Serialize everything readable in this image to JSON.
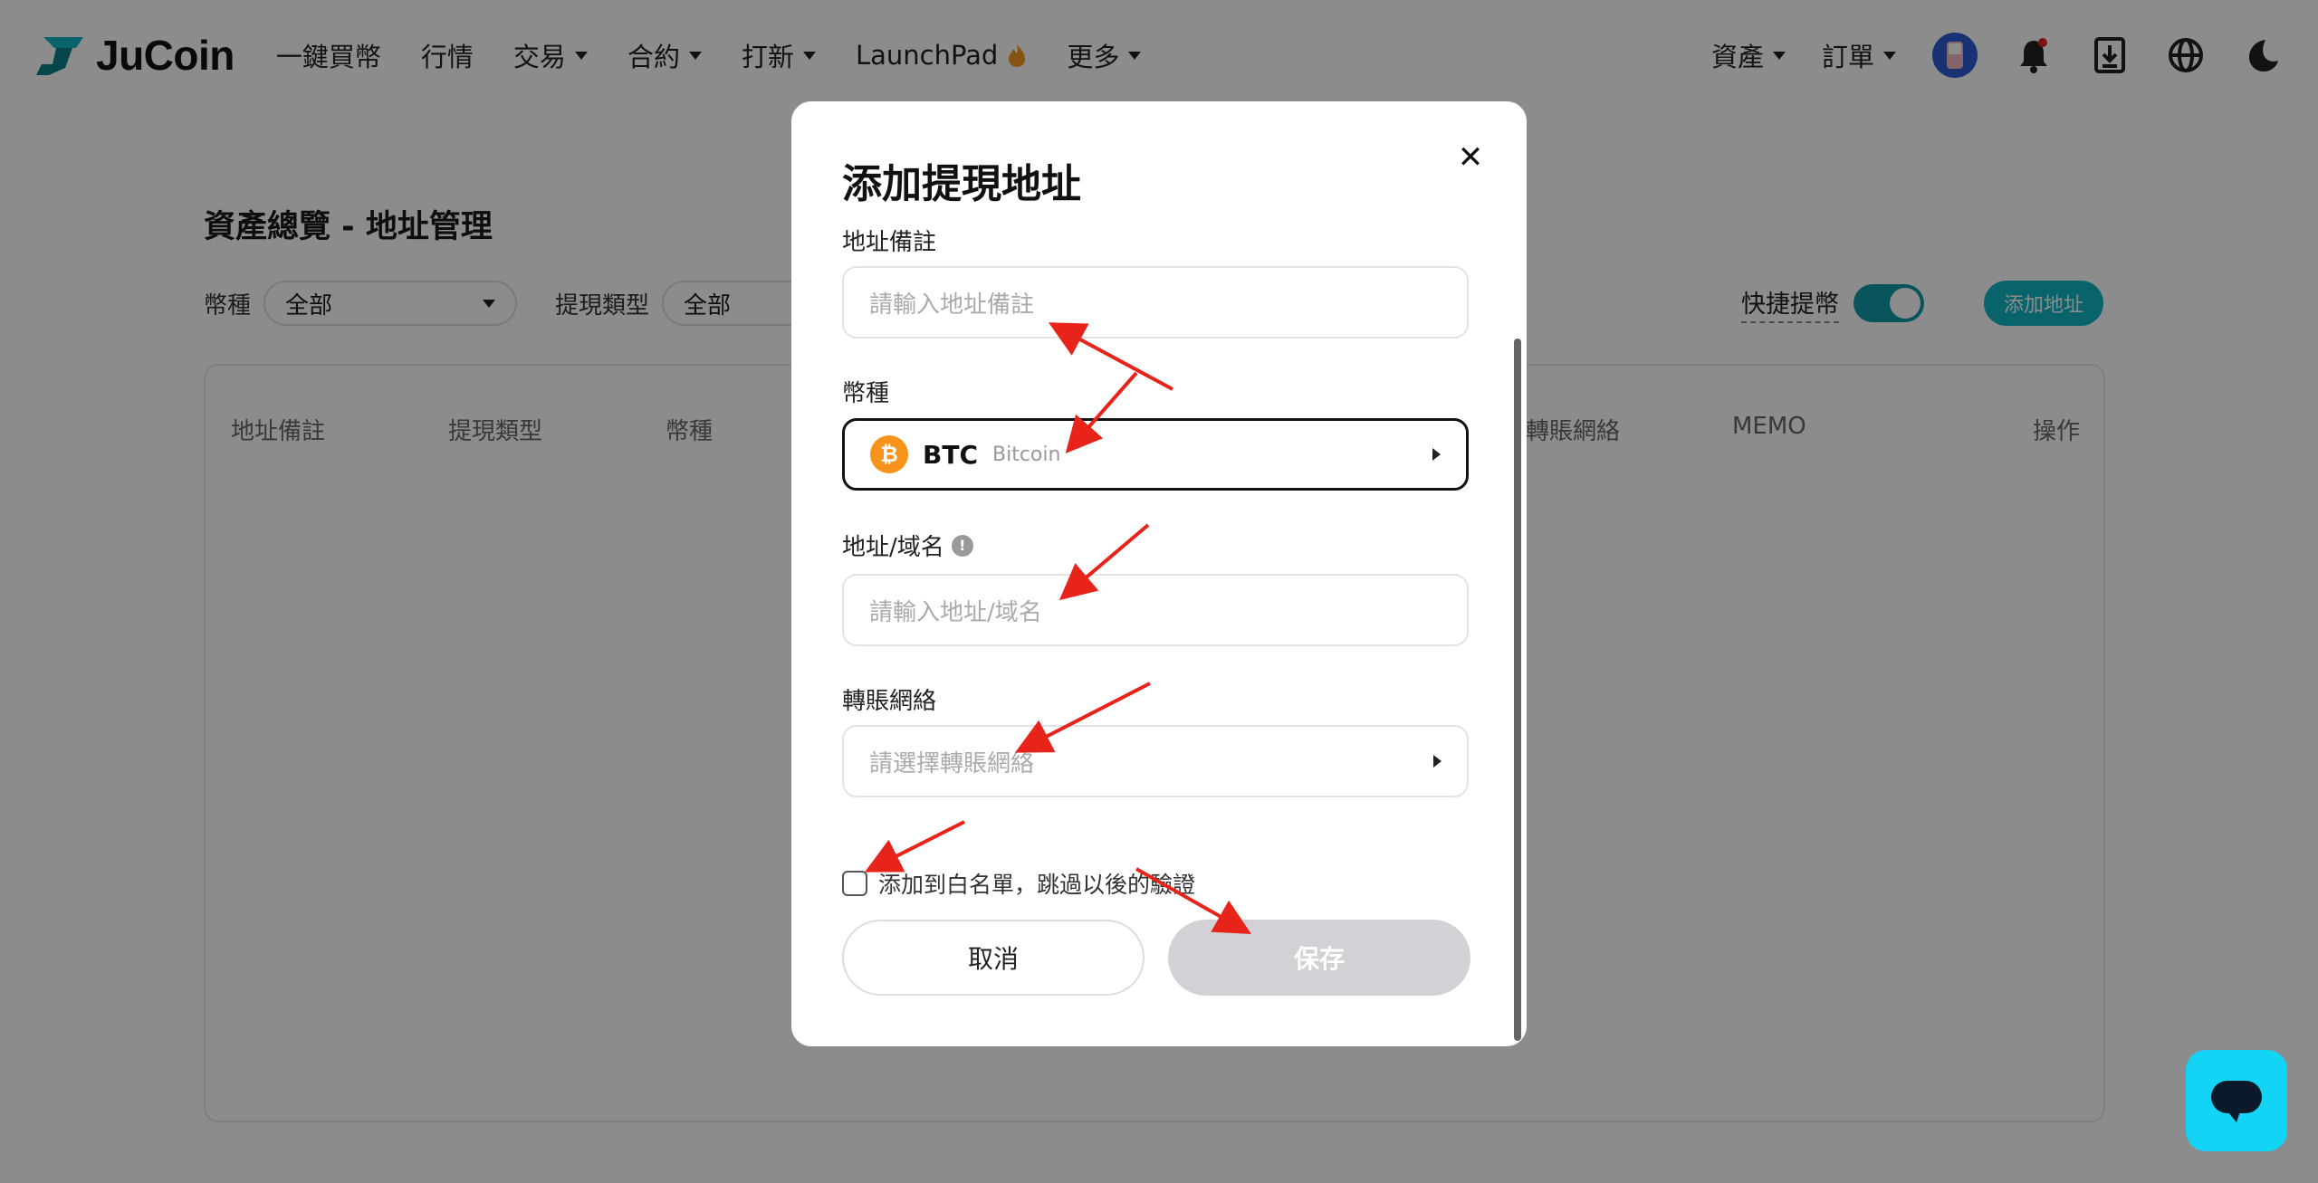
{
  "header": {
    "logo_text": "JuCoin",
    "nav": [
      {
        "label": "一鍵買幣",
        "dropdown": false
      },
      {
        "label": "行情",
        "dropdown": false
      },
      {
        "label": "交易",
        "dropdown": true
      },
      {
        "label": "合約",
        "dropdown": true
      },
      {
        "label": "打新",
        "dropdown": true
      },
      {
        "label": "LaunchPad",
        "dropdown": false
      },
      {
        "label": "更多",
        "dropdown": true
      }
    ],
    "assets_label": "資產",
    "orders_label": "訂單",
    "icons": [
      "avatar",
      "bell-icon",
      "download-icon",
      "globe-icon",
      "moon-icon"
    ]
  },
  "page": {
    "title": "資產總覽 - 地址管理",
    "filter_coin_label": "幣種",
    "filter_coin_value": "全部",
    "filter_type_label": "提現類型",
    "filter_type_value": "全部",
    "quick_withdraw_label": "快捷提幣",
    "quick_withdraw_on": true,
    "add_address_label": "添加地址",
    "table_headers": [
      "地址備註",
      "提現類型",
      "幣種",
      "轉賬網絡",
      "MEMO",
      "操作"
    ]
  },
  "modal": {
    "title": "添加提現地址",
    "remark_label": "地址備註",
    "remark_placeholder": "請輸入地址備註",
    "coin_label": "幣種",
    "coin_symbol": "BTC",
    "coin_name": "Bitcoin",
    "address_label": "地址/域名",
    "address_placeholder": "請輸入地址/域名",
    "network_label": "轉賬網絡",
    "network_placeholder": "請選擇轉賬網絡",
    "whitelist_label": "添加到白名單，跳過以後的驗證",
    "whitelist_checked": false,
    "cancel_label": "取消",
    "save_label": "保存"
  },
  "colors": {
    "accent": "#0fb6c1",
    "btc": "#f7931a",
    "chat": "#13d4f4",
    "annotation": "#e8231a"
  }
}
